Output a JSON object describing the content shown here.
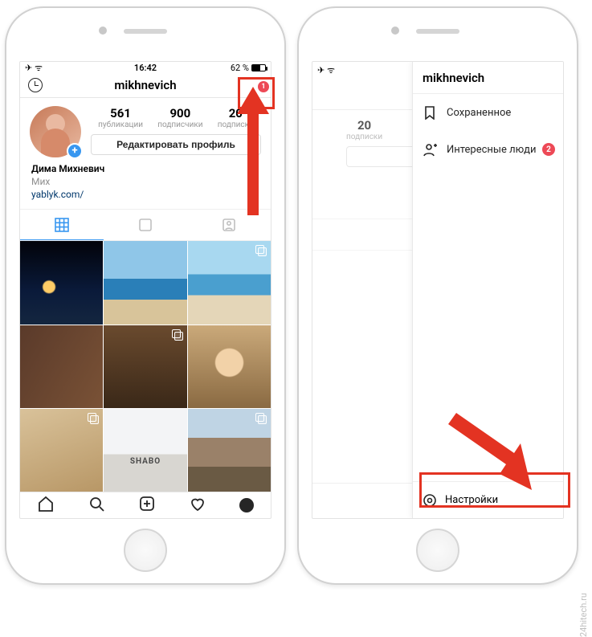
{
  "status": {
    "time": "16:42",
    "battery": "62 %"
  },
  "profile": {
    "username": "mikhnevich",
    "name": "Дима Михневич",
    "subtitle": "Мих",
    "link": "yablyk.com/",
    "edit_label": "Редактировать профиль",
    "menu_badge": "1",
    "stats": [
      {
        "num": "561",
        "label": "публикации"
      },
      {
        "num": "900",
        "label": "подписчики"
      },
      {
        "num": "20",
        "label": "подписки"
      }
    ]
  },
  "grid_brand": "SHABO",
  "right": {
    "visible_stat_num": "20",
    "visible_stat_label": "подписки",
    "sidebar": {
      "title": "mikhnevich",
      "items": [
        {
          "label": "Сохраненное",
          "icon": "bookmark-icon"
        },
        {
          "label": "Интересные люди",
          "icon": "add-person-icon",
          "badge": "2"
        }
      ],
      "settings_label": "Настройки"
    }
  },
  "watermark": "24hitech.ru"
}
